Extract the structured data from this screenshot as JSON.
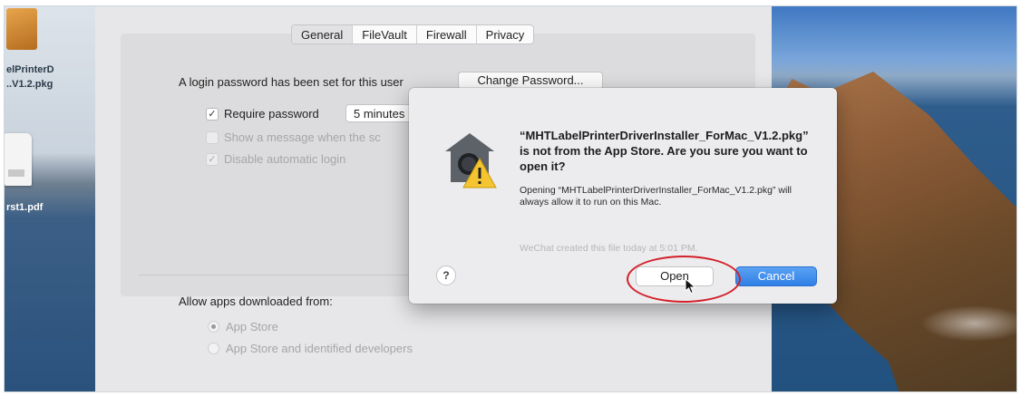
{
  "desktop": {
    "top_file_label_line1": "elPrinterD",
    "top_file_label_line2": "..V1.2.pkg",
    "second_file_label": "rst1.pdf"
  },
  "prefs": {
    "tabs": [
      {
        "label": "General",
        "selected": true
      },
      {
        "label": "FileVault",
        "selected": false
      },
      {
        "label": "Firewall",
        "selected": false
      },
      {
        "label": "Privacy",
        "selected": false
      }
    ],
    "login_password_text": "A login password has been set for this user",
    "change_password_label": "Change Password...",
    "require_password_label": "Require password",
    "require_password_checked": true,
    "require_password_value": "5 minutes",
    "show_message_label": "Show a message when the sc",
    "disable_login_label": "Disable automatic login",
    "allow_apps_label": "Allow apps downloaded from:",
    "option_app_store": "App Store",
    "option_app_store_identified": "App Store and identified developers"
  },
  "dialog": {
    "title": "“MHTLabelPrinterDriverInstaller_ForMac_V1.2.pkg” is not from the App Store. Are you sure you want to open it?",
    "body": "Opening “MHTLabelPrinterDriverInstaller_ForMac_V1.2.pkg” will always allow it to run on this Mac.",
    "faint_text": "WeChat created this file today at 5:01 PM.",
    "help_label": "?",
    "open_label": "Open",
    "cancel_label": "Cancel"
  },
  "colors": {
    "accent_blue": "#2f7fe6",
    "highlight_red": "#d3212a",
    "warning_yellow": "#f5c431"
  }
}
